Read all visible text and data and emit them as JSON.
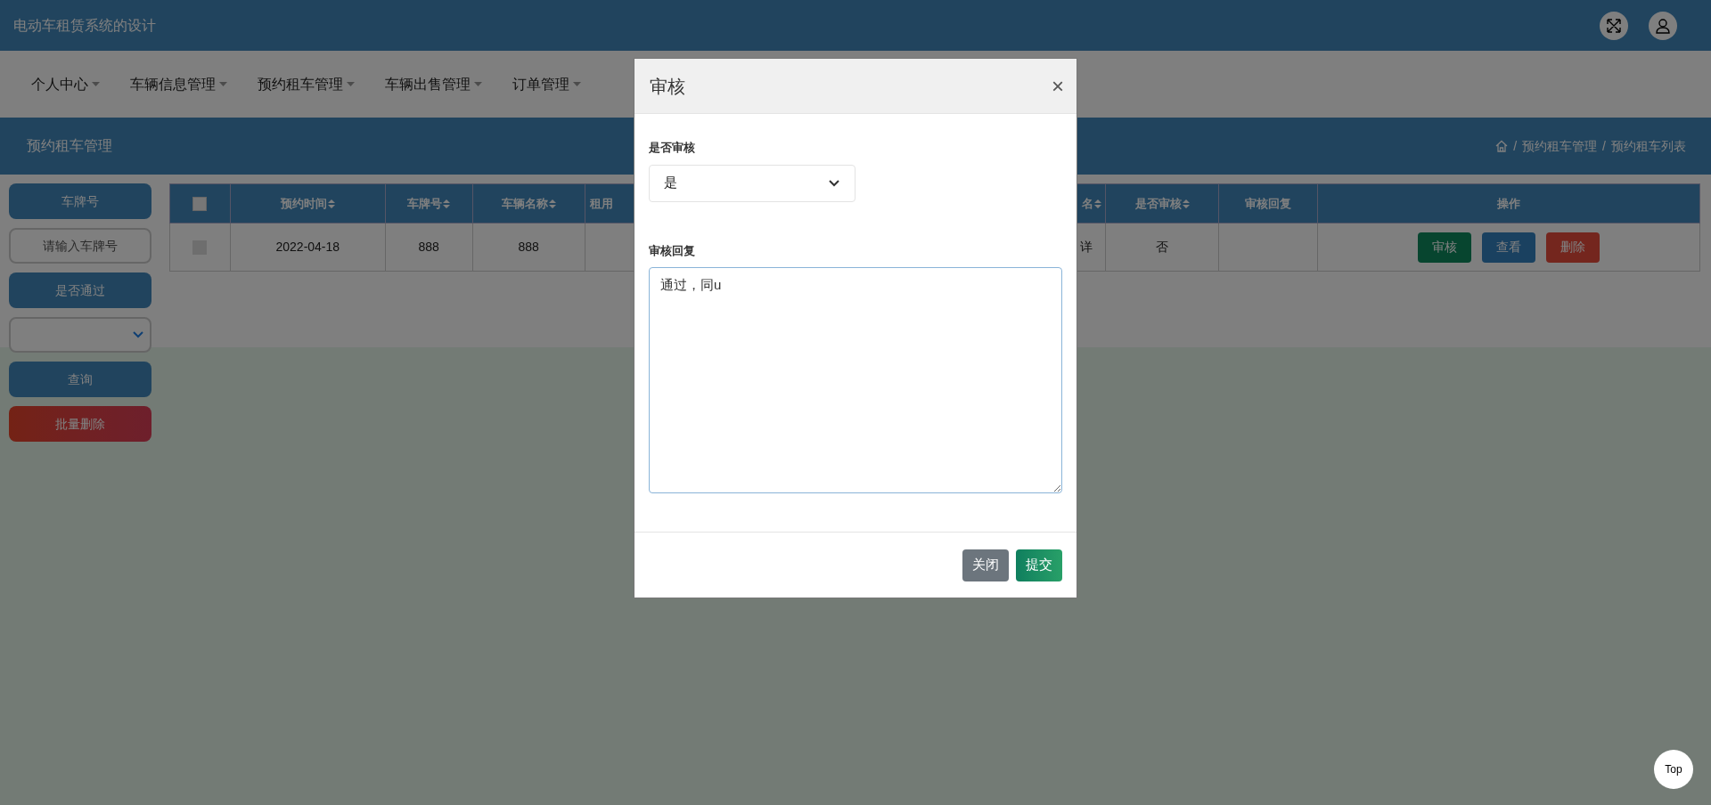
{
  "header": {
    "title": "电动车租赁系统的设计"
  },
  "nav": {
    "items": [
      {
        "label": "个人中心"
      },
      {
        "label": "车辆信息管理"
      },
      {
        "label": "预约租车管理"
      },
      {
        "label": "车辆出售管理"
      },
      {
        "label": "订单管理"
      }
    ]
  },
  "section": {
    "title": "预约租车管理",
    "breadcrumb": [
      {
        "separator": "/",
        "label": "预约租车管理"
      },
      {
        "separator": "/",
        "label": "预约租车列表"
      }
    ]
  },
  "filters": {
    "plate_label": "车牌号",
    "plate_placeholder": "请输入车牌号",
    "pass_label": "是否通过",
    "search_button": "查询",
    "batch_delete_button": "批量删除"
  },
  "table": {
    "columns": [
      {
        "kind": "checkbox",
        "checked": false
      },
      {
        "kind": "text",
        "label": "预约时间",
        "sortable": true
      },
      {
        "kind": "text",
        "label": "车牌号",
        "sortable": true
      },
      {
        "kind": "text",
        "label": "车辆名称",
        "sortable": true
      },
      {
        "kind": "fragment_left",
        "label": "租用",
        "sortable": false
      },
      {
        "kind": "fragment_right",
        "label": "名",
        "sortable": true
      },
      {
        "kind": "text",
        "label": "是否审核",
        "sortable": true
      },
      {
        "kind": "text",
        "label": "审核回复",
        "sortable": false
      },
      {
        "kind": "text",
        "label": "操作",
        "sortable": false
      }
    ],
    "rows": [
      {
        "checked": false,
        "date": "2022-04-18",
        "plate": "888",
        "name": "888",
        "column_6": "详",
        "reviewed": "否",
        "actions": [
          {
            "label": "审核",
            "kind": "review"
          },
          {
            "label": "查看",
            "kind": "view"
          },
          {
            "label": "删除",
            "kind": "delete"
          }
        ]
      }
    ]
  },
  "dialog": {
    "title": "审核",
    "close": "×",
    "fields": [
      {
        "kind": "select",
        "label": "是否审核",
        "value": "是"
      },
      {
        "kind": "textarea",
        "label": "审核回复",
        "value": "通过，同u"
      }
    ],
    "buttons": [
      {
        "label": "关闭",
        "kind": "secondary"
      },
      {
        "label": "提交",
        "kind": "primary"
      }
    ]
  },
  "back_to_top": "Top"
}
